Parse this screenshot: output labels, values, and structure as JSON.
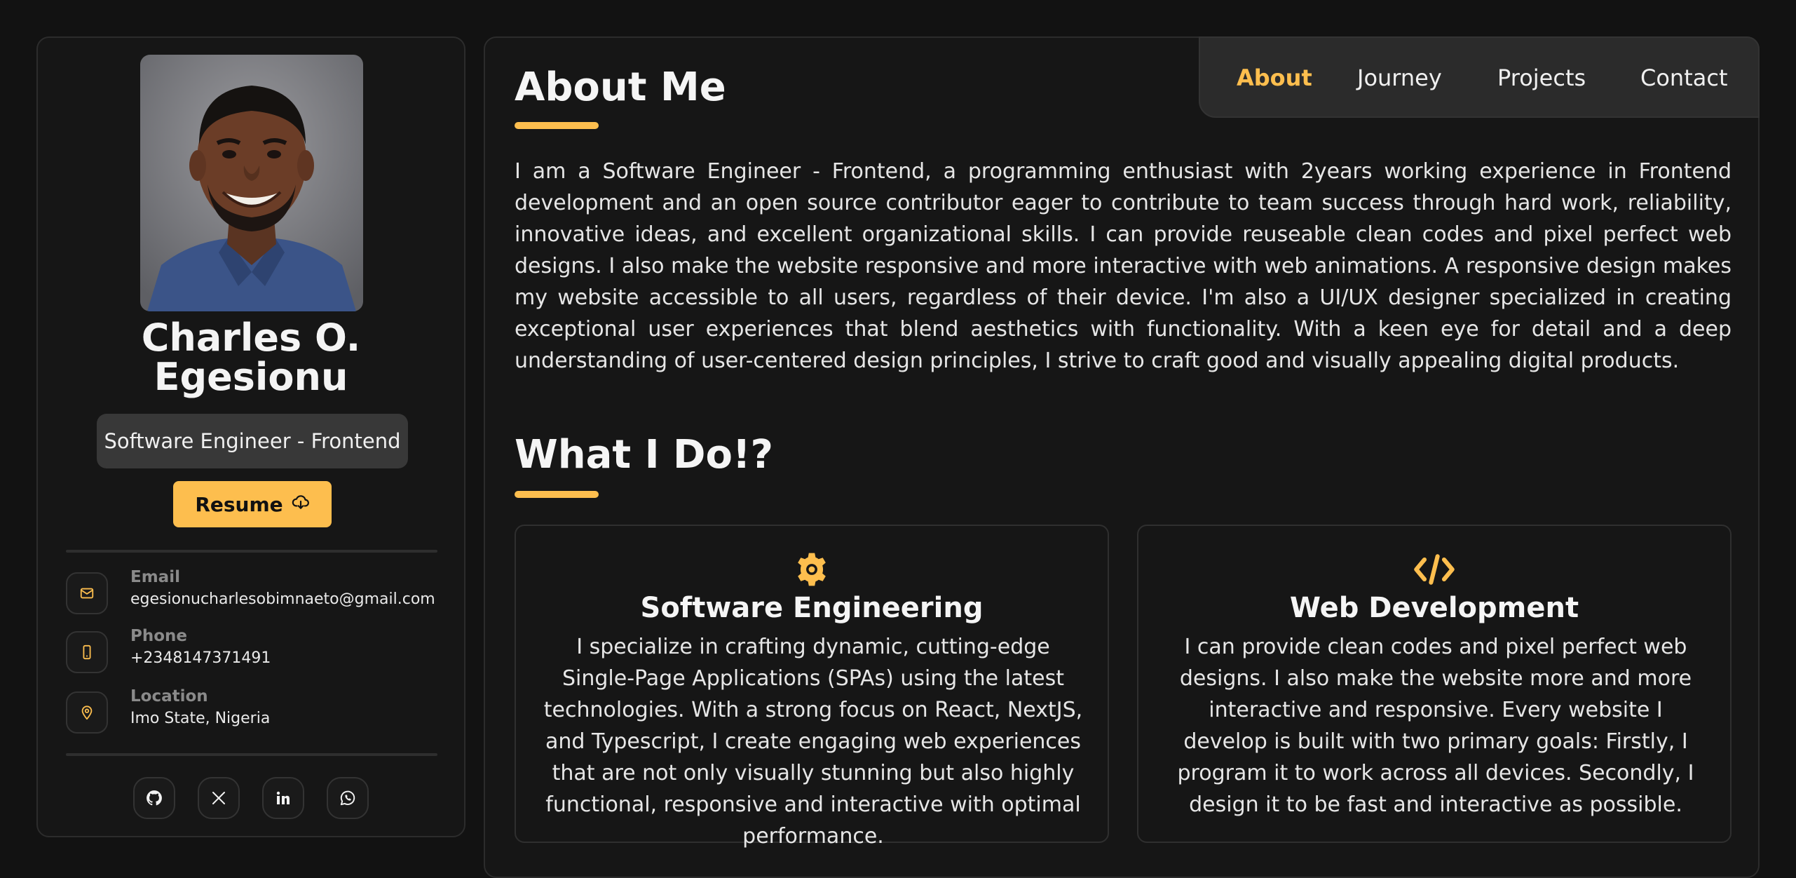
{
  "profile": {
    "name_line1": "Charles O.",
    "name_line2": "Egesionu",
    "role": "Software Engineer - Frontend",
    "resume_label": "Resume"
  },
  "contacts": [
    {
      "label": "Email",
      "value": "egesionucharlesobimnaeto@gmail.com",
      "icon": "mail-icon"
    },
    {
      "label": "Phone",
      "value": "+2348147371491",
      "icon": "phone-icon"
    },
    {
      "label": "Location",
      "value": "Imo State, Nigeria",
      "icon": "location-pin-icon"
    }
  ],
  "socials": [
    "github-icon",
    "x-twitter-icon",
    "linkedin-icon",
    "whatsapp-icon"
  ],
  "nav": {
    "items": [
      "About",
      "Journey",
      "Projects",
      "Contact"
    ],
    "active": "About"
  },
  "about": {
    "title": "About Me",
    "text": "I am a Software Engineer - Frontend, a programming enthusiast with 2years working experience in Frontend development and an open source contributor eager to contribute to team success through hard work, reliability, innovative ideas, and excellent organizational skills. I can provide reuseable clean codes and pixel perfect web designs. I also make the website responsive and more interactive with web animations. A responsive design makes my website accessible to all users, regardless of their device. I'm also a UI/UX designer specialized in creating exceptional user experiences that blend aesthetics with functionality. With a keen eye for detail and a deep understanding of user-centered design principles, I strive to craft good and visually appealing digital products."
  },
  "services": {
    "title": "What I Do!?",
    "items": [
      {
        "icon": "gear-icon",
        "title": "Software Engineering",
        "text": "I specialize in crafting dynamic, cutting-edge Single-Page Applications (SPAs) using the latest technologies. With a strong focus on React, NextJS, and Typescript, I create engaging web experiences that are not only visually stunning but also highly functional, responsive and interactive with optimal performance."
      },
      {
        "icon": "code-icon",
        "title": "Web Development",
        "text": "I can provide clean codes and pixel perfect web designs. I also make the website more and more interactive and responsive. Every website I develop is built with two primary goals: Firstly, I program it to work across all devices. Secondly, I design it to be fast and interactive as possible."
      }
    ]
  },
  "colors": {
    "accent": "#fdbe4e",
    "background": "#121212",
    "card": "#161616",
    "pill": "#383838"
  }
}
